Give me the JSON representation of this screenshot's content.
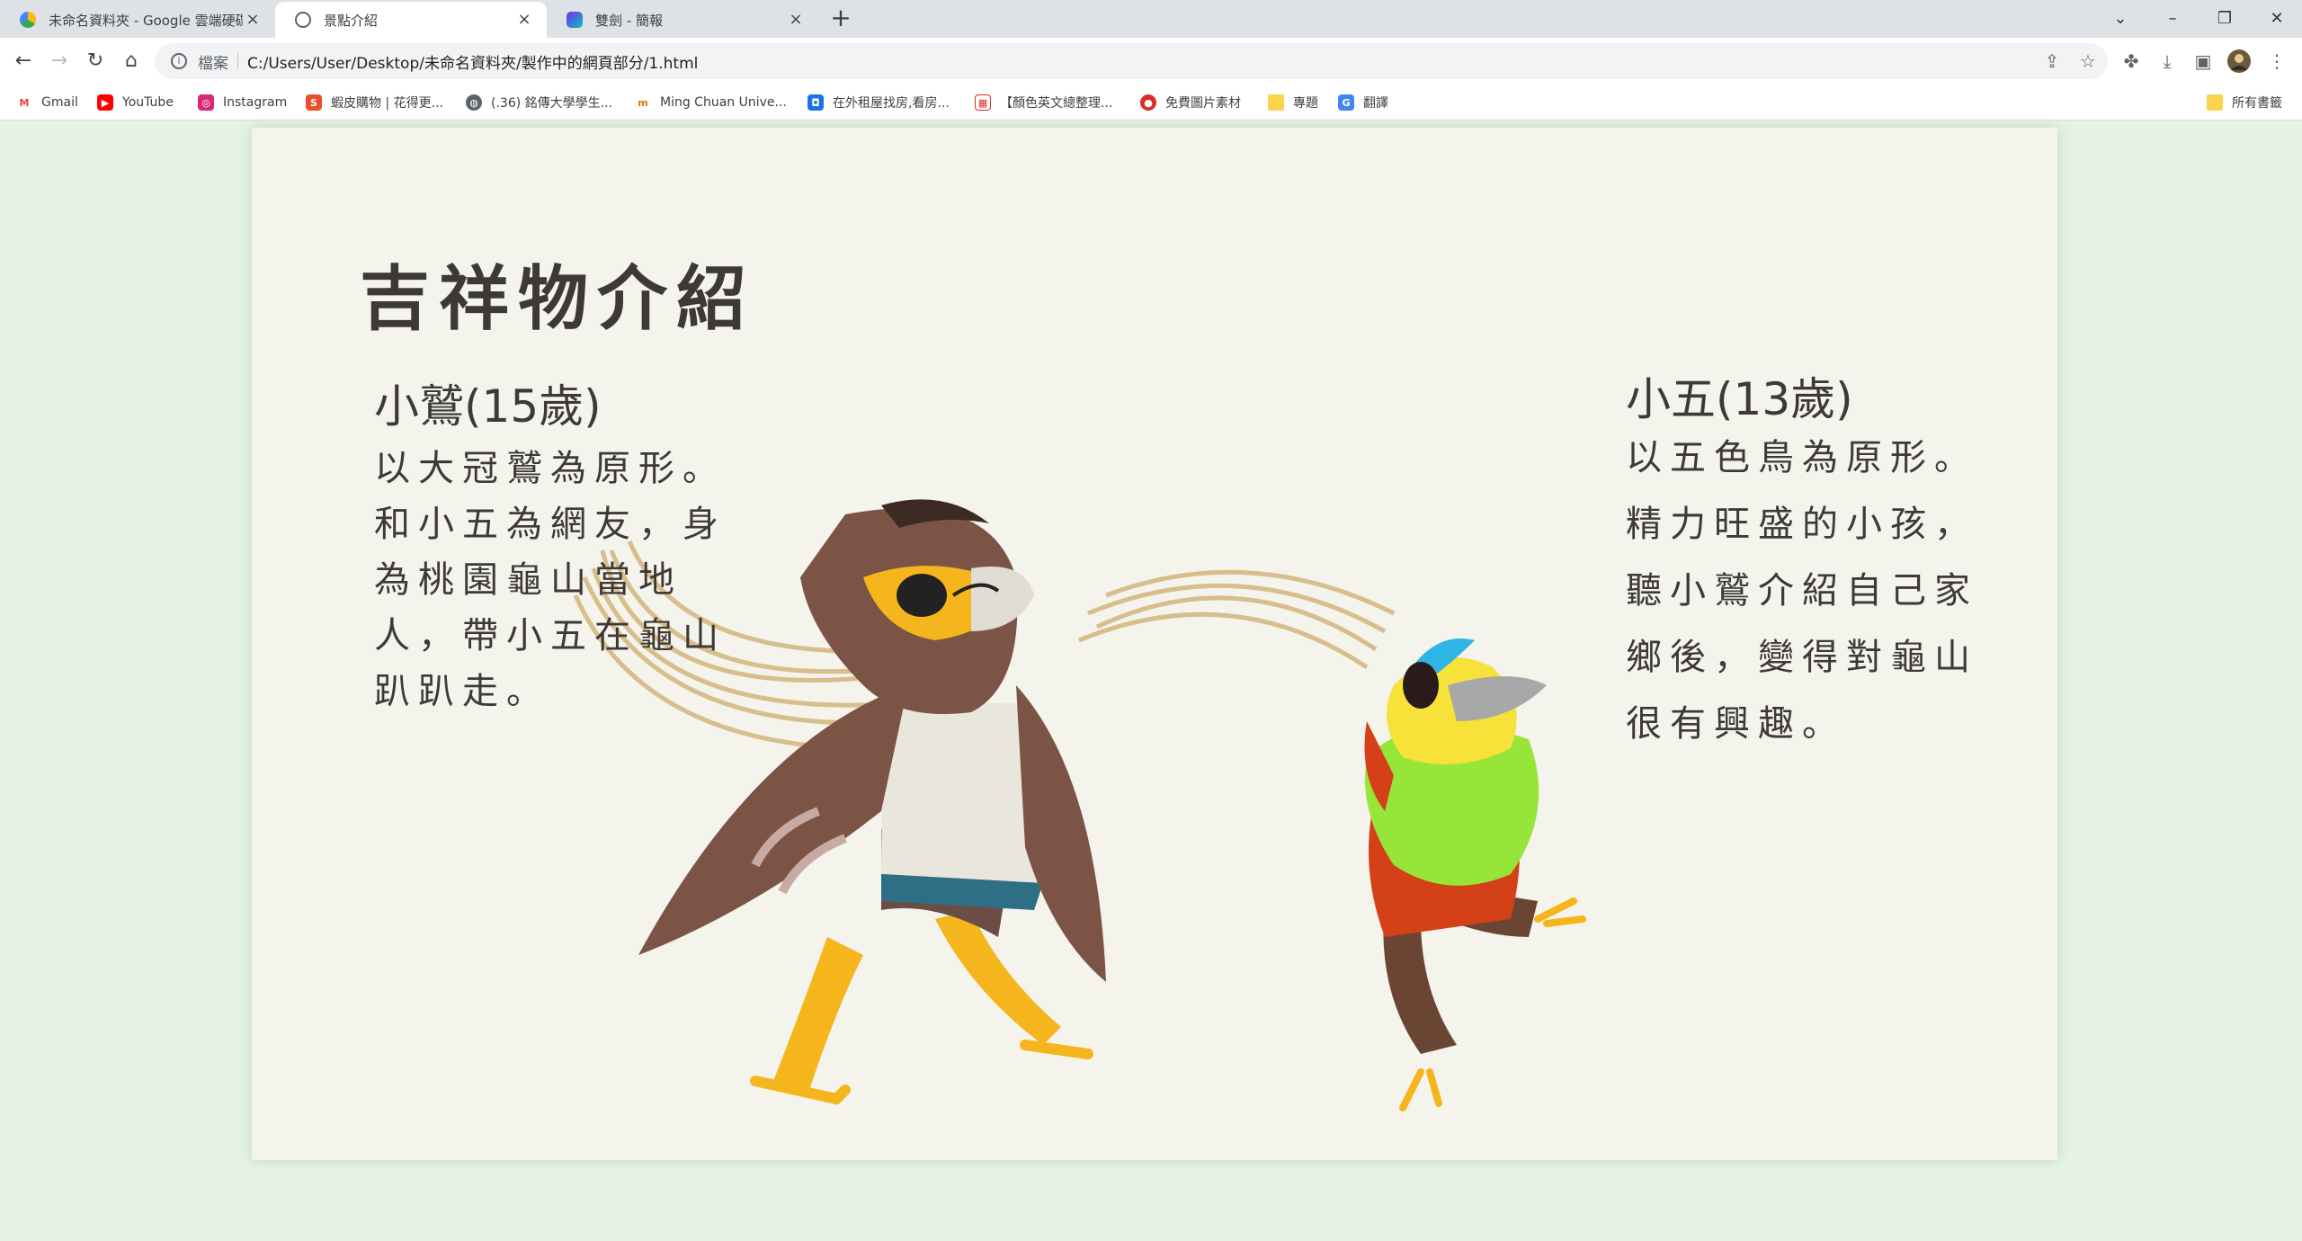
{
  "browser": {
    "tabs": [
      {
        "title": "未命名資料夾 - Google 雲端硬碟",
        "close": "×",
        "active": false
      },
      {
        "title": "景點介紹",
        "close": "×",
        "active": true
      },
      {
        "title": "雙劍 - 簡報",
        "close": "×",
        "active": false
      }
    ],
    "new_tab": "+",
    "window_controls": {
      "dropdown": "⌄",
      "minimize": "–",
      "restore": "❐",
      "close": "✕"
    },
    "nav": {
      "back": "←",
      "forward": "→",
      "reload": "↻",
      "home": "⌂"
    },
    "address": {
      "scheme_label": "檔案",
      "url": "C:/Users/User/Desktop/未命名資料夾/製作中的網頁部分/1.html"
    },
    "bookmarks": [
      {
        "label": "Gmail",
        "color": "#ea4335",
        "glyph": "M"
      },
      {
        "label": "YouTube",
        "color": "#ff0000",
        "glyph": "▶"
      },
      {
        "label": "Instagram",
        "color": "#d62976",
        "glyph": "◎"
      },
      {
        "label": "蝦皮購物 | 花得更...",
        "color": "#ee4d2d",
        "glyph": "S"
      },
      {
        "label": "(.36) 銘傳大學學生...",
        "color": "#5f6368",
        "glyph": "◍"
      },
      {
        "label": "Ming Chuan Unive...",
        "color": "#f4b400",
        "glyph": "m"
      },
      {
        "label": "在外租屋找房,看房...",
        "color": "#1a73e8",
        "glyph": "◘"
      },
      {
        "label": "【顏色英文總整理...",
        "color": "#d93025",
        "glyph": "▦"
      },
      {
        "label": "免費圖片素材",
        "color": "#d93025",
        "glyph": "●"
      },
      {
        "label": "專題",
        "color": "#fbd34d",
        "glyph": ""
      },
      {
        "label": "翻譯",
        "color": "#4285f4",
        "glyph": "G"
      }
    ],
    "all_bookmarks": "所有書籤"
  },
  "page": {
    "heading": "吉祥物介紹",
    "left": {
      "name": "小鷲(15歲)",
      "lines": [
        "以大冠鷲為原形。",
        "和小五為網友，身",
        "為桃園龜山當地",
        "人，帶小五在龜山",
        "趴趴走。"
      ]
    },
    "right": {
      "name": "小五(13歲)",
      "lines": [
        "以五色鳥為原形。",
        "精力旺盛的小孩，",
        "聽小鷲介紹自己家",
        "鄉後，變得對龜山",
        "很有興趣。"
      ]
    }
  },
  "colors": {
    "page_bg": "#e4f3e6",
    "card_bg": "#f4f3ec",
    "text": "#3d3a36"
  }
}
